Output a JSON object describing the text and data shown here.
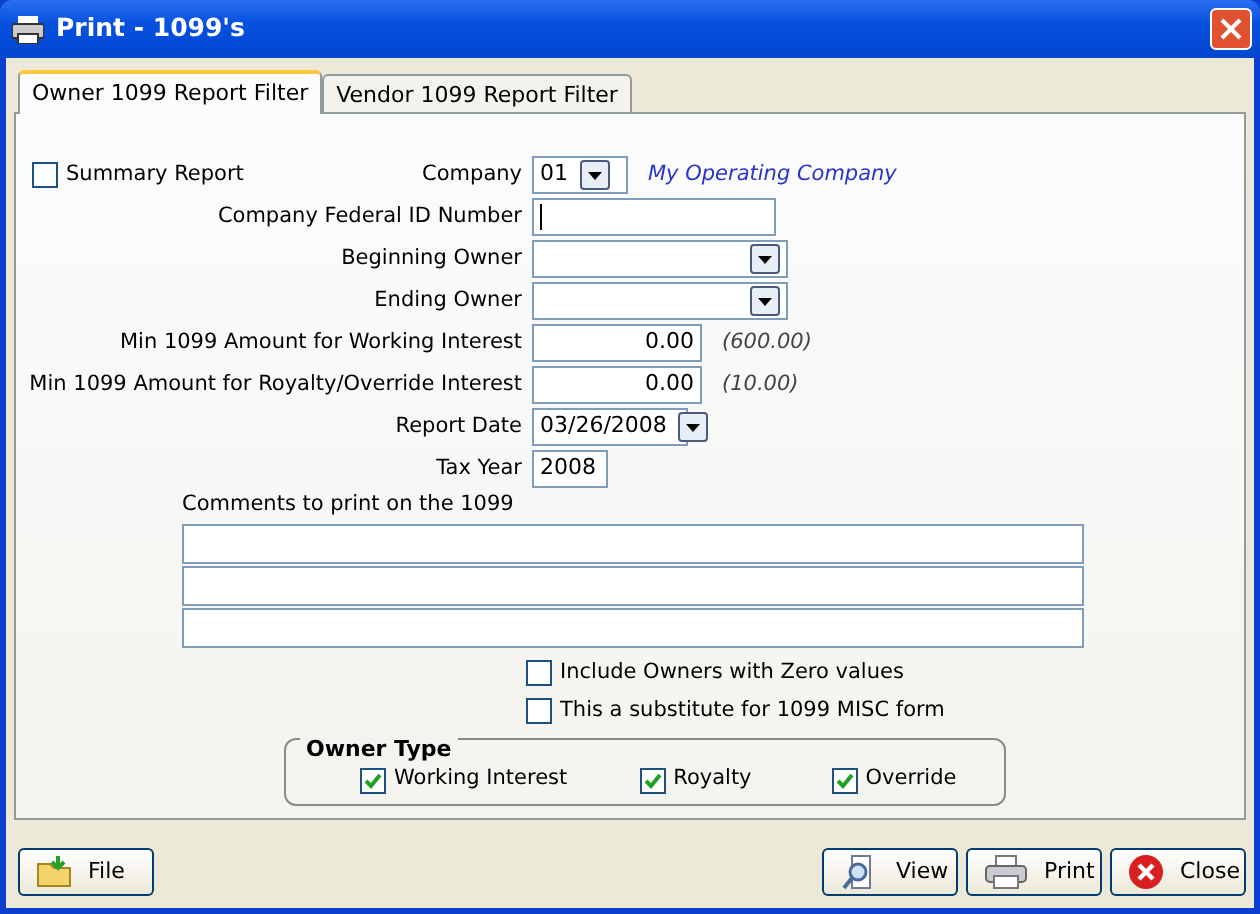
{
  "window": {
    "title": "Print - 1099's"
  },
  "tabs": [
    {
      "label": "Owner 1099 Report Filter",
      "selected": true
    },
    {
      "label": "Vendor 1099 Report Filter",
      "selected": false
    }
  ],
  "summary_report": {
    "label": "Summary Report",
    "checked": false
  },
  "fields": [
    {
      "kind": "code",
      "label": "Company",
      "value": "01",
      "note": "My Operating Company"
    },
    {
      "kind": "text",
      "label": "Company Federal ID Number"
    },
    {
      "kind": "combo",
      "label": "Beginning Owner"
    },
    {
      "kind": "combo",
      "label": "Ending Owner"
    },
    {
      "kind": "amount",
      "label": "Min 1099 Amount for Working Interest",
      "value": "0.00",
      "note": "(600.00)"
    },
    {
      "kind": "amount",
      "label": "Min 1099 Amount for Royalty/Override Interest",
      "value": "0.00",
      "note": "(10.00)"
    },
    {
      "kind": "date",
      "label": "Report Date",
      "value": "03/26/2008"
    },
    {
      "kind": "year",
      "label": "Tax Year",
      "value": "2008"
    }
  ],
  "comments": {
    "label": "Comments to print on the 1099",
    "lines": [
      {
        "kind": "text"
      },
      {
        "kind": "text"
      },
      {
        "kind": "text"
      }
    ]
  },
  "options": [
    {
      "label": "Include Owners with Zero values",
      "checked": false
    },
    {
      "label": "This a substitute for 1099 MISC form",
      "checked": false
    }
  ],
  "owner_type": {
    "title": "Owner Type",
    "items": [
      {
        "label": "Working Interest",
        "checked": true
      },
      {
        "label": "Royalty",
        "checked": true
      },
      {
        "label": "Override",
        "checked": true
      }
    ]
  },
  "buttons": [
    {
      "kind": "file",
      "label": "File"
    },
    {
      "kind": "view",
      "label": "View"
    },
    {
      "kind": "print",
      "label": "Print"
    },
    {
      "kind": "close",
      "label": "Close"
    }
  ]
}
